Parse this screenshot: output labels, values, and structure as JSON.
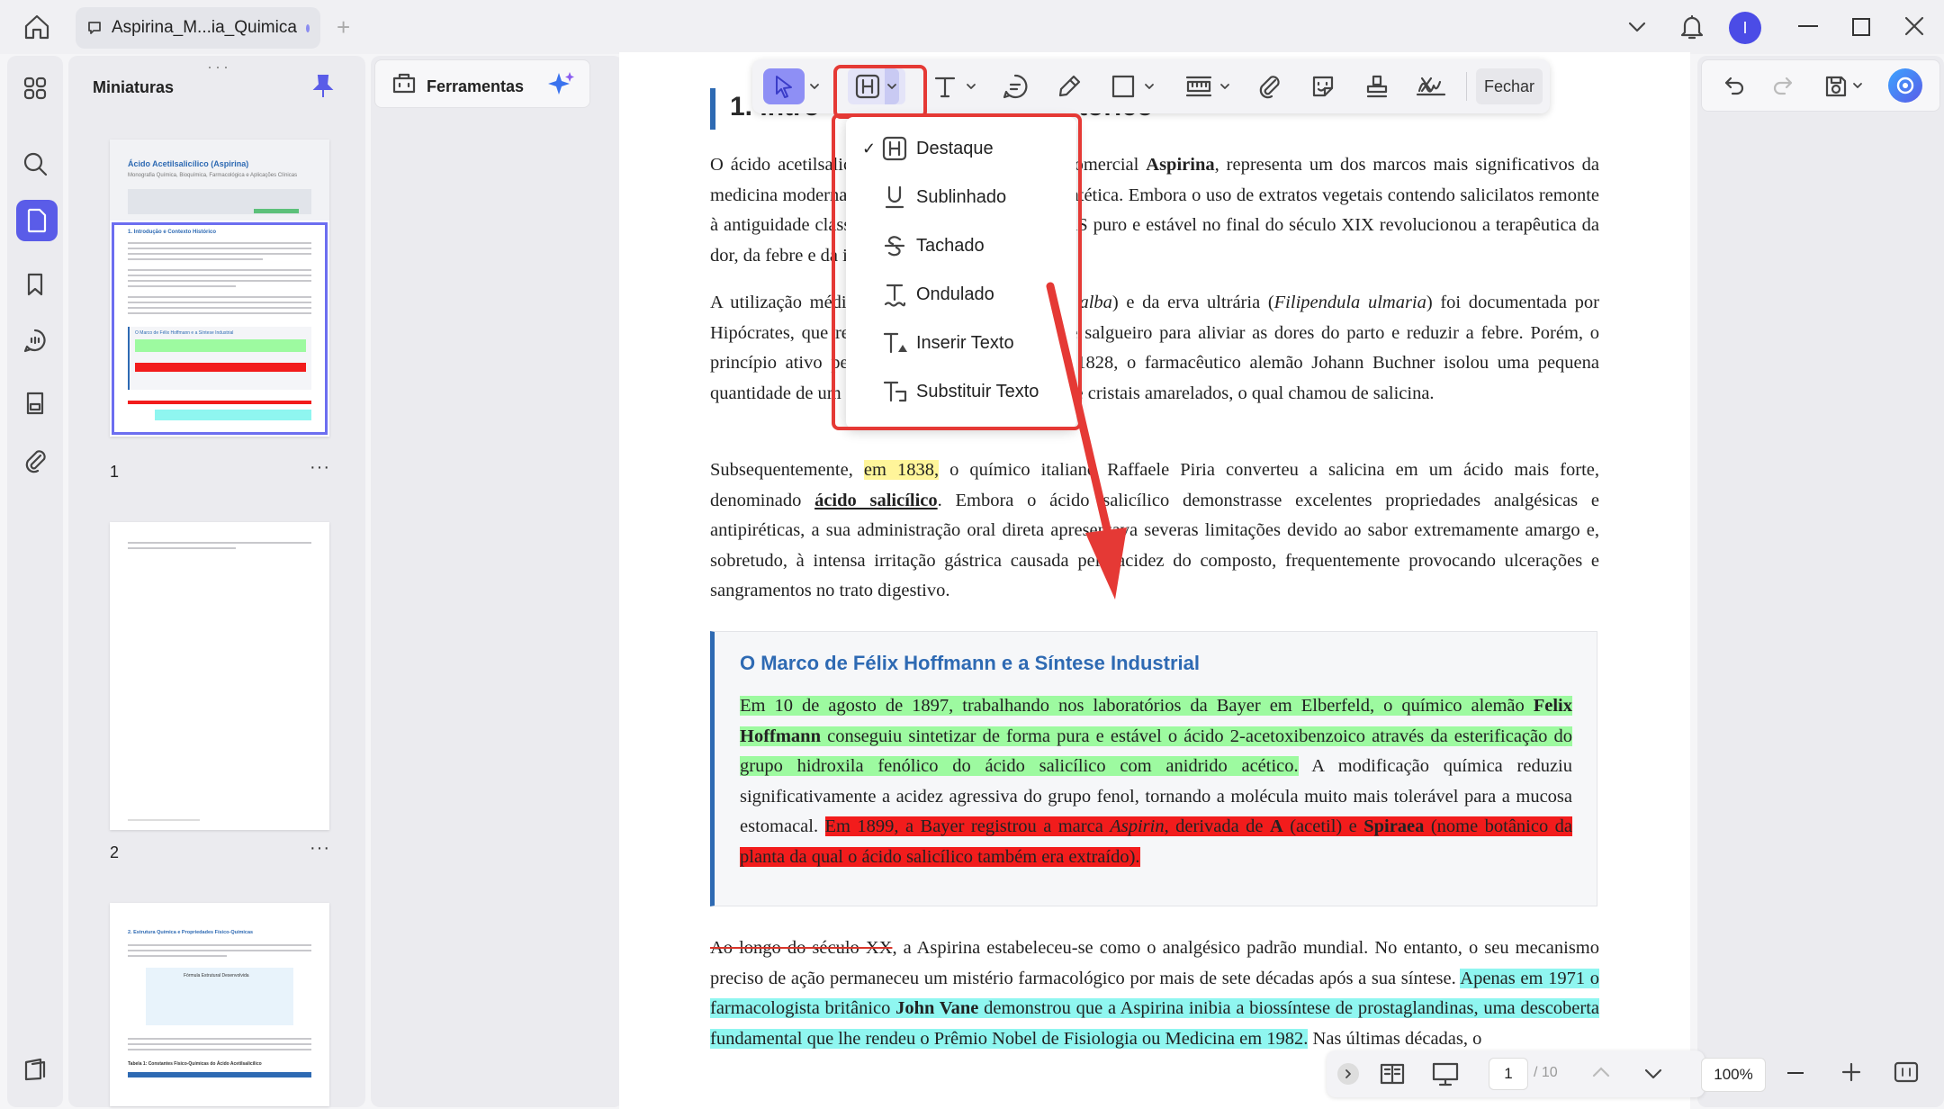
{
  "tab": {
    "title": "Aspirina_M...ia_Quimica"
  },
  "user": {
    "avatar_letter": "I"
  },
  "thumbnails": {
    "title": "Miniaturas",
    "pages": [
      {
        "number": "1"
      },
      {
        "number": "2"
      }
    ],
    "page1": {
      "title": "Ácido Acetilsalicílico (Aspirina)",
      "sub": "Monografia Química, Bioquímica, Farmacológica e Aplicações Clínicas",
      "section": "1. Introdução e Contexto Histórico",
      "box_title": "O Marco de Félix Hoffmann e a Síntese Industrial"
    },
    "page3": {
      "title": "2. Estrutura Química e Propriedades Físico-Químicas",
      "formula_title": "Fórmula Estrutural Desenvolvida",
      "table_title": "Tabela 1: Constantes Físico-Químicas do Ácido Acetilsalicílico"
    }
  },
  "tools": {
    "label": "Ferramentas"
  },
  "toolbar": {
    "close_label": "Fechar"
  },
  "menu": {
    "items": [
      {
        "label": "Destaque",
        "checked": true,
        "icon": "highlight-icon"
      },
      {
        "label": "Sublinhado",
        "icon": "underline-icon"
      },
      {
        "label": "Tachado",
        "icon": "strikethrough-icon"
      },
      {
        "label": "Ondulado",
        "icon": "squiggly-icon"
      },
      {
        "label": "Inserir Texto",
        "icon": "insert-text-icon"
      },
      {
        "label": "Substituir Texto",
        "icon": "replace-text-icon"
      }
    ]
  },
  "document": {
    "heading_visible": "1. Intro",
    "heading_tail": "tórico",
    "p1": {
      "a": "O ácido acetilsalicílico, conhecido pelo nome comercial ",
      "b": "Aspirina",
      "c": ", representa um dos marcos mais significativos da medicina moderna e da indústria farmacêutica sintética. Embora o uso de extratos vegetais contendo salicilatos remonte à antiguidade clássica, o desenvolvimento do AAS puro e estável no final do século XIX revolucionou a terapêutica da dor, da febre e da inflamação."
    },
    "p2": {
      "a": "A utilização médica do salgueiro-branco (",
      "b": "Salix alba",
      "c": ") e da erva ultrária (",
      "d": "Filipendula ulmaria",
      "e": ") foi documentada por Hipócrates, que recomendava o chá de casca de salgueiro para aliviar as dores do parto e reduzir a febre. Porém, o princípio ativo permaneceu desconhecido. Em 1828, o farmacêutico alemão Johann Buchner isolou uma pequena quantidade de um glucosídeo amargo em forma de cristais amarelados, o qual chamou de salicina."
    },
    "p3": {
      "a": "Subsequentemente, ",
      "b": "em 1838,",
      "c": " o químico italiano Raffaele Piria converteu a salicina em um ácido mais forte, denominado ",
      "d": " ácido salicílico",
      "e": ". Embora o ácido salicílico demonstrasse excelentes propriedades analgésicas e antipiréticas, a sua administração oral direta apresentava severas limitações devido ao sabor extremamente amargo e, sobretudo, à intensa irritação gástrica causada pela acidez do composto, frequentemente provocando ulcerações e sangramentos no trato digestivo."
    },
    "callout": {
      "title": "O Marco de Félix Hoffmann e a Síntese Industrial",
      "a": "Em 10 de agosto de 1897, trabalhando nos laboratórios da Bayer em Elberfeld, o químico alemão ",
      "b": "Felix Hoffmann",
      "c": " conseguiu sintetizar de forma pura e estável o ácido 2-acetoxibenzoico através da esterificação do grupo hidroxila fenólico do ácido salicílico com anidrido acético.",
      "d": " A modificação química reduziu significativamente a acidez agressiva do grupo fenol, tornando a molécula muito mais tolerável para a mucosa estomacal. ",
      "e": "Em 1899, a Bayer registrou a marca ",
      "f": "Aspirin",
      "g": ", derivada de ",
      "h": "A",
      "i": " (acetil) e ",
      "j": "Spiraea",
      "k": " (nome botânico da planta da qual o ácido salicílico também era extraído)."
    },
    "p4": {
      "a": "Ao longo do século XX",
      "b": ", a Aspirina estabeleceu-se como o analgésico padrão mundial. No entanto, o seu mecanismo preciso de ação permaneceu um mistério farmacológico por mais de sete décadas após a sua síntese. ",
      "c": "Apenas em 1971 o farmacologista britânico ",
      "d": "John Vane",
      "e": " demonstrou que a Aspirina inibia a biossíntese de prostaglandinas, uma descoberta fundamental que lhe rendeu o Prêmio Nobel de Fisiologia ou Medicina em 1982.",
      "f": " Nas últimas décadas, o"
    }
  },
  "pagination": {
    "current": "1",
    "total": "/ 10",
    "zoom": "100%"
  },
  "colors": {
    "accent": "#5a5ce8",
    "annotation_red": "#e53935",
    "highlight_yellow": "#fff59a",
    "highlight_green": "#9dfaa0",
    "highlight_red": "#f21c1c",
    "highlight_cyan": "#8ff6f0",
    "callout_blue": "#2e6ab3"
  }
}
